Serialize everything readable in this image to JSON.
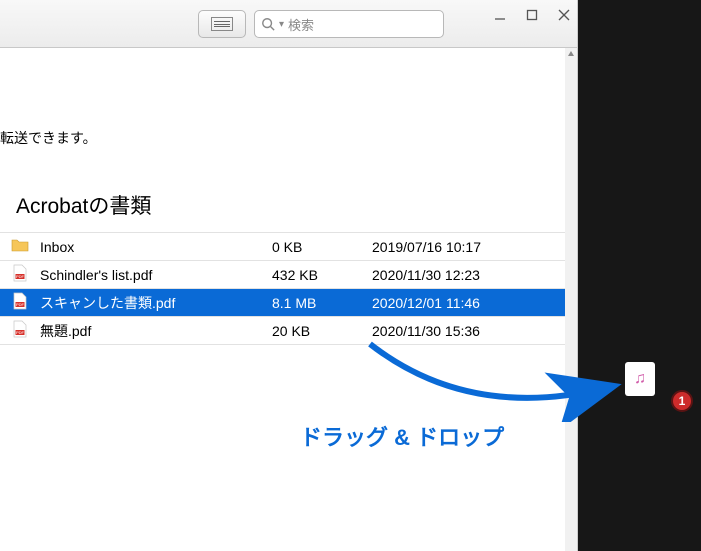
{
  "window": {
    "search_placeholder": "検索"
  },
  "content": {
    "transfer_hint": "転送できます。",
    "heading": "Acrobatの書類"
  },
  "files": [
    {
      "name": "Inbox",
      "size": "0 KB",
      "date": "2019/07/16 10:17",
      "kind": "folder",
      "selected": false
    },
    {
      "name": "Schindler's list.pdf",
      "size": "432 KB",
      "date": "2020/11/30 12:23",
      "kind": "pdf",
      "selected": false
    },
    {
      "name": "スキャンした書類.pdf",
      "size": "8.1 MB",
      "date": "2020/12/01 11:46",
      "kind": "pdf",
      "selected": true
    },
    {
      "name": "無題.pdf",
      "size": "20 KB",
      "date": "2020/11/30 15:36",
      "kind": "pdf",
      "selected": false
    }
  ],
  "annotation": {
    "text": "ドラッグ & ドロップ"
  },
  "desktop": {
    "badge_count": "1"
  }
}
